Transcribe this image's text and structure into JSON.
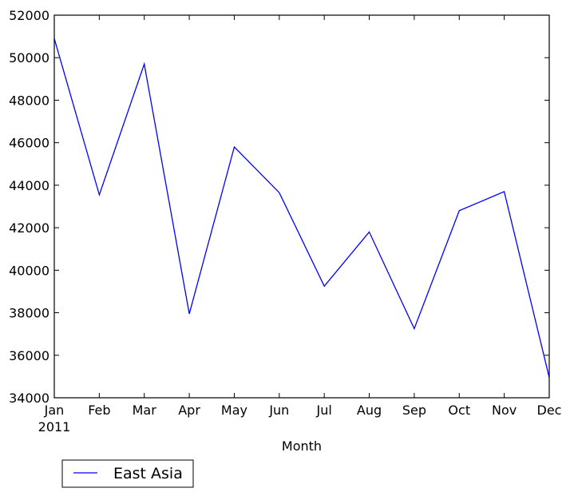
{
  "chart_data": {
    "type": "line",
    "title": "",
    "xlabel": "Month",
    "ylabel": "",
    "categories": [
      "Jan",
      "Feb",
      "Mar",
      "Apr",
      "May",
      "Jun",
      "Jul",
      "Aug",
      "Sep",
      "Oct",
      "Nov",
      "Dec"
    ],
    "x_sublabel": "2011",
    "ylim": [
      34000,
      52000
    ],
    "yticks": [
      34000,
      36000,
      38000,
      40000,
      42000,
      44000,
      46000,
      48000,
      50000,
      52000
    ],
    "grid": false,
    "legend_position": "below-left",
    "series": [
      {
        "name": "East Asia",
        "color": "#0000ff",
        "values": [
          50900,
          43550,
          49700,
          37950,
          45800,
          43650,
          39250,
          41800,
          37250,
          42800,
          43700,
          34950
        ]
      }
    ]
  }
}
